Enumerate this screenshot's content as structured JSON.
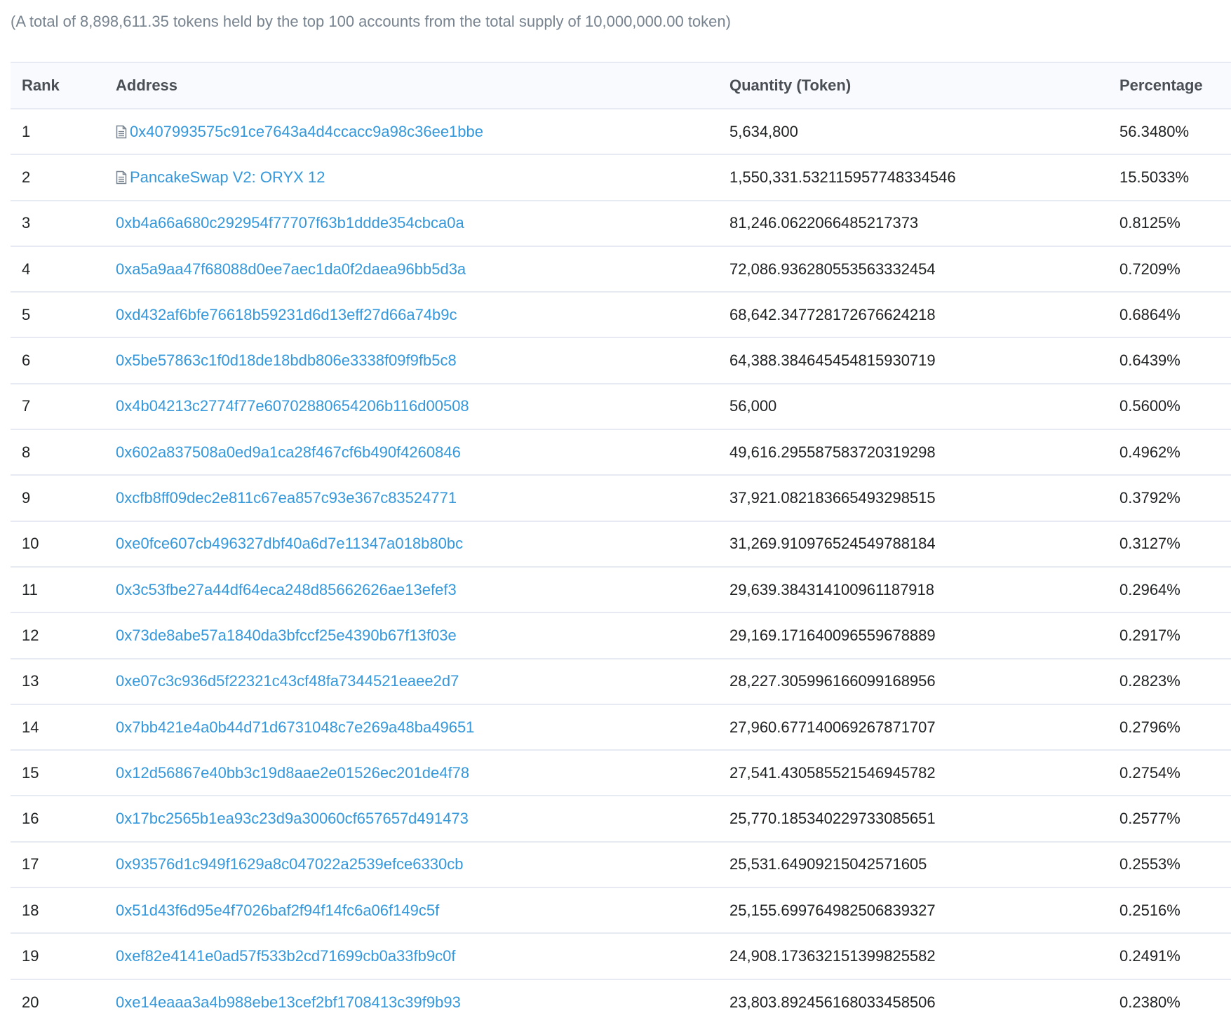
{
  "summary": "(A total of 8,898,611.35 tokens held by the top 100 accounts from the total supply of 10,000,000.00 token)",
  "columns": {
    "rank": "Rank",
    "address": "Address",
    "quantity": "Quantity (Token)",
    "percentage": "Percentage"
  },
  "colors": {
    "link": "#3498db",
    "header_bg": "#f8fafd",
    "border": "#e7eaf3",
    "muted_text": "#77838f"
  },
  "rows": [
    {
      "rank": "1",
      "address": "0x407993575c91ce7643a4d4ccacc9a98c36ee1bbe",
      "contract_icon": true,
      "icon": "contract-document-icon",
      "quantity": "5,634,800",
      "percentage": "56.3480%"
    },
    {
      "rank": "2",
      "address": "PancakeSwap V2: ORYX 12",
      "contract_icon": true,
      "icon": "contract-document-icon",
      "quantity": "1,550,331.532115957748334546",
      "percentage": "15.5033%"
    },
    {
      "rank": "3",
      "address": "0xb4a66a680c292954f77707f63b1ddde354cbca0a",
      "contract_icon": false,
      "quantity": "81,246.0622066485217373",
      "percentage": "0.8125%"
    },
    {
      "rank": "4",
      "address": "0xa5a9aa47f68088d0ee7aec1da0f2daea96bb5d3a",
      "contract_icon": false,
      "quantity": "72,086.936280553563332454",
      "percentage": "0.7209%"
    },
    {
      "rank": "5",
      "address": "0xd432af6bfe76618b59231d6d13eff27d66a74b9c",
      "contract_icon": false,
      "quantity": "68,642.347728172676624218",
      "percentage": "0.6864%"
    },
    {
      "rank": "6",
      "address": "0x5be57863c1f0d18de18bdb806e3338f09f9fb5c8",
      "contract_icon": false,
      "quantity": "64,388.384645454815930719",
      "percentage": "0.6439%"
    },
    {
      "rank": "7",
      "address": "0x4b04213c2774f77e60702880654206b116d00508",
      "contract_icon": false,
      "quantity": "56,000",
      "percentage": "0.5600%"
    },
    {
      "rank": "8",
      "address": "0x602a837508a0ed9a1ca28f467cf6b490f4260846",
      "contract_icon": false,
      "quantity": "49,616.295587583720319298",
      "percentage": "0.4962%"
    },
    {
      "rank": "9",
      "address": "0xcfb8ff09dec2e811c67ea857c93e367c83524771",
      "contract_icon": false,
      "quantity": "37,921.082183665493298515",
      "percentage": "0.3792%"
    },
    {
      "rank": "10",
      "address": "0xe0fce607cb496327dbf40a6d7e11347a018b80bc",
      "contract_icon": false,
      "quantity": "31,269.910976524549788184",
      "percentage": "0.3127%"
    },
    {
      "rank": "11",
      "address": "0x3c53fbe27a44df64eca248d85662626ae13efef3",
      "contract_icon": false,
      "quantity": "29,639.384314100961187918",
      "percentage": "0.2964%"
    },
    {
      "rank": "12",
      "address": "0x73de8abe57a1840da3bfccf25e4390b67f13f03e",
      "contract_icon": false,
      "quantity": "29,169.171640096559678889",
      "percentage": "0.2917%"
    },
    {
      "rank": "13",
      "address": "0xe07c3c936d5f22321c43cf48fa7344521eaee2d7",
      "contract_icon": false,
      "quantity": "28,227.305996166099168956",
      "percentage": "0.2823%"
    },
    {
      "rank": "14",
      "address": "0x7bb421e4a0b44d71d6731048c7e269a48ba49651",
      "contract_icon": false,
      "quantity": "27,960.677140069267871707",
      "percentage": "0.2796%"
    },
    {
      "rank": "15",
      "address": "0x12d56867e40bb3c19d8aae2e01526ec201de4f78",
      "contract_icon": false,
      "quantity": "27,541.430585521546945782",
      "percentage": "0.2754%"
    },
    {
      "rank": "16",
      "address": "0x17bc2565b1ea93c23d9a30060cf657657d491473",
      "contract_icon": false,
      "quantity": "25,770.185340229733085651",
      "percentage": "0.2577%"
    },
    {
      "rank": "17",
      "address": "0x93576d1c949f1629a8c047022a2539efce6330cb",
      "contract_icon": false,
      "quantity": "25,531.64909215042571605",
      "percentage": "0.2553%"
    },
    {
      "rank": "18",
      "address": "0x51d43f6d95e4f7026baf2f94f14fc6a06f149c5f",
      "contract_icon": false,
      "quantity": "25,155.699764982506839327",
      "percentage": "0.2516%"
    },
    {
      "rank": "19",
      "address": "0xef82e4141e0ad57f533b2cd71699cb0a33fb9c0f",
      "contract_icon": false,
      "quantity": "24,908.173632151399825582",
      "percentage": "0.2491%"
    },
    {
      "rank": "20",
      "address": "0xe14eaaa3a4b988ebe13cef2bf1708413c39f9b93",
      "contract_icon": false,
      "quantity": "23,803.892456168033458506",
      "percentage": "0.2380%"
    }
  ]
}
